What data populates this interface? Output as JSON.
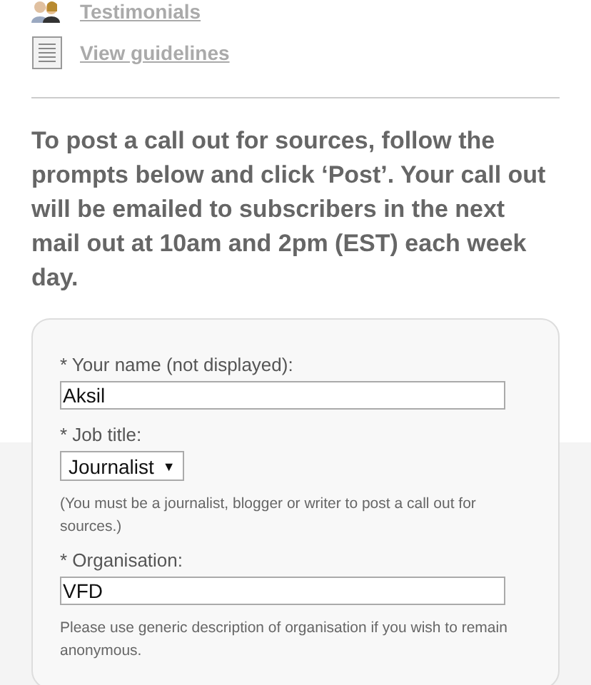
{
  "links": [
    {
      "kind": "people",
      "label": "Testimonials"
    },
    {
      "kind": "document",
      "label": "View guidelines"
    }
  ],
  "intro": "To post a call out for sources, follow the prompts below and click ‘Post’. Your call out will be emailed to subscribers in the next mail out at 10am and 2pm (EST) each week day.",
  "form": {
    "fields": [
      {
        "kind": "text",
        "label": "* Your name (not displayed):",
        "value": "Aksil"
      },
      {
        "kind": "select",
        "label": "* Job title:",
        "value": "Journalist",
        "arrow": "▼",
        "note": "(You must be a journalist, blogger or writer to post a call out for sources.)"
      },
      {
        "kind": "text",
        "label": "* Organisation:",
        "value": "VFD",
        "note": "Please use generic description of organisation if you wish to remain anonymous."
      }
    ]
  }
}
